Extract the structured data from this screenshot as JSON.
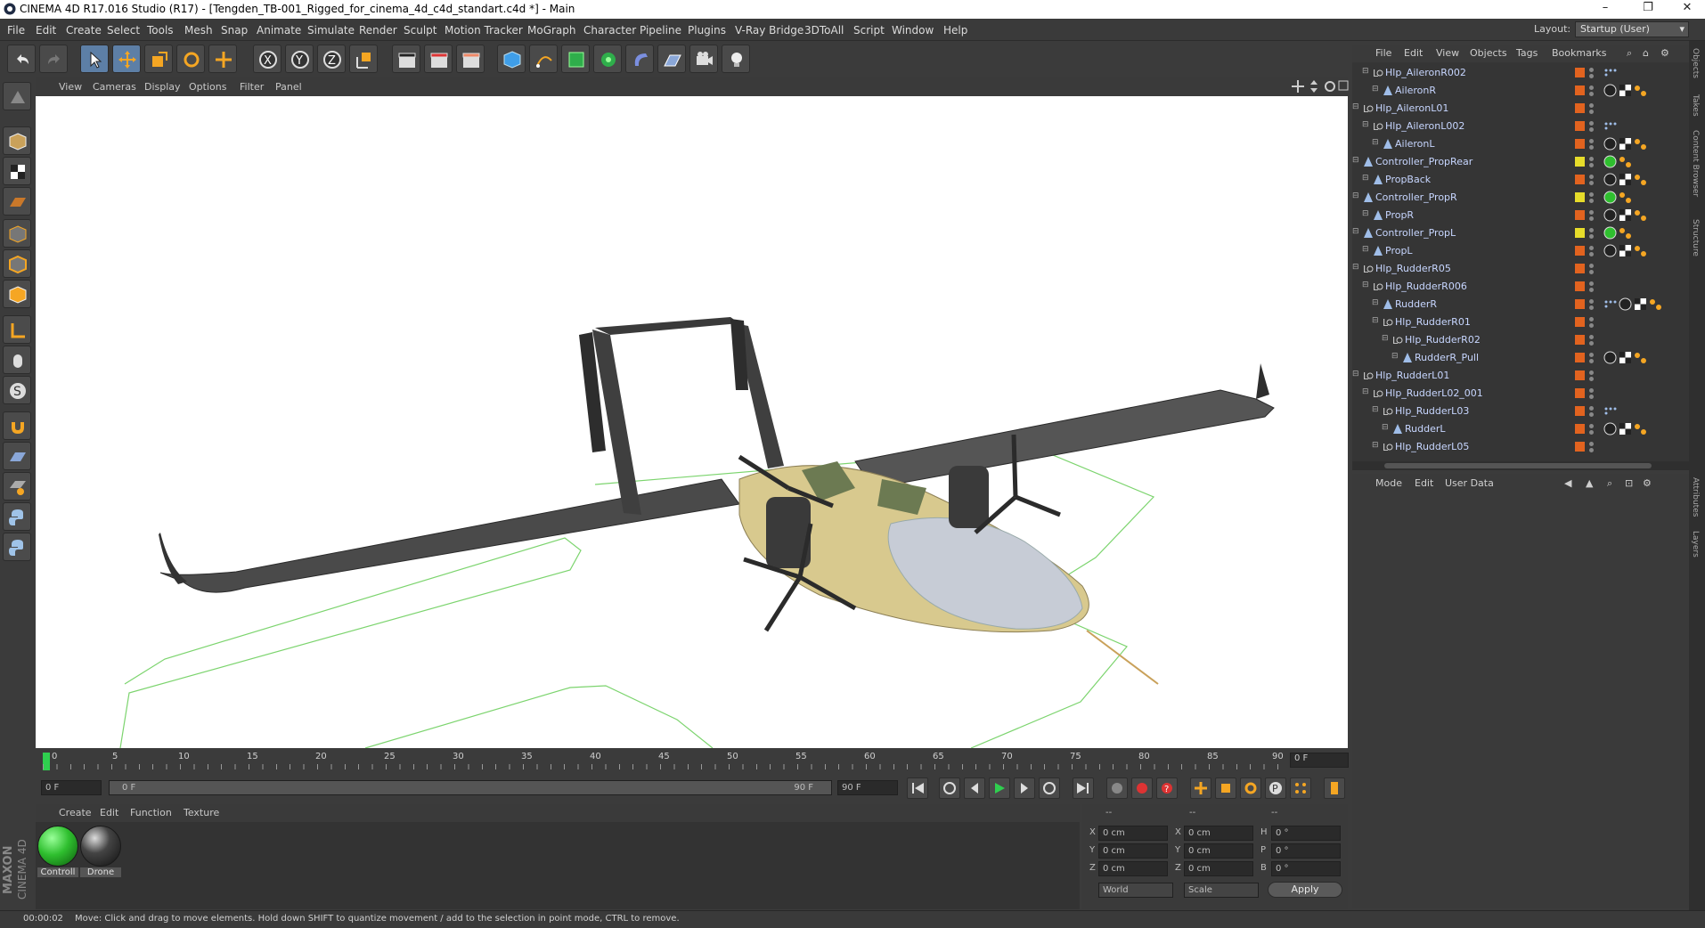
{
  "window": {
    "title": "CINEMA 4D R17.016 Studio (R17) - [Tengden_TB-001_Rigged_for_cinema_4d_c4d_standart.c4d *] - Main",
    "minimize": "–",
    "maximize": "❐",
    "close": "✕"
  },
  "menu": [
    "File",
    "Edit",
    "Create",
    "Select",
    "Tools",
    "Mesh",
    "Snap",
    "Animate",
    "Simulate",
    "Render",
    "Sculpt",
    "Motion Tracker",
    "MoGraph",
    "Character",
    "Pipeline",
    "Plugins",
    "V-Ray Bridge",
    "3DToAll",
    "Script",
    "Window",
    "Help"
  ],
  "layout": {
    "label": "Layout:",
    "value": "Startup (User)"
  },
  "viewport_menu": [
    "View",
    "Cameras",
    "Display",
    "Options",
    "Filter",
    "Panel"
  ],
  "timeline": {
    "ticks": [
      "0",
      "5",
      "10",
      "15",
      "20",
      "25",
      "30",
      "35",
      "40",
      "45",
      "50",
      "55",
      "60",
      "65",
      "70",
      "75",
      "80",
      "85",
      "90"
    ],
    "current_frame": "0 F",
    "start": "0 F",
    "range_start": "0 F",
    "range_end": "90 F",
    "end": "90 F"
  },
  "material_menu": [
    "Create",
    "Edit",
    "Function",
    "Texture"
  ],
  "materials": [
    {
      "name": "Controll",
      "color": "#2fbf2f"
    },
    {
      "name": "Drone",
      "color": "#2a2a2a"
    }
  ],
  "coords": {
    "headers": [
      "--",
      "--",
      "--"
    ],
    "rows": [
      {
        "a": "X",
        "av": "0 cm",
        "b": "X",
        "bv": "0 cm",
        "c": "H",
        "cv": "0 °"
      },
      {
        "a": "Y",
        "av": "0 cm",
        "b": "Y",
        "bv": "0 cm",
        "c": "P",
        "cv": "0 °"
      },
      {
        "a": "Z",
        "av": "0 cm",
        "b": "Z",
        "bv": "0 cm",
        "c": "B",
        "cv": "0 °"
      }
    ],
    "world": "World",
    "scale": "Scale",
    "apply": "Apply"
  },
  "brand": {
    "line1": "MAXON",
    "line2": "CINEMA 4D"
  },
  "status": {
    "time": "00:00:02",
    "message": "Move: Click and drag to move elements. Hold down SHIFT to quantize movement / add to the selection in point mode, CTRL to remove."
  },
  "object_manager": {
    "menu": [
      "File",
      "Edit",
      "View",
      "Objects",
      "Tags",
      "Bookmarks"
    ],
    "rows": [
      {
        "name": "Hlp_AileronR002",
        "indent": 1,
        "icon": "null",
        "flag": "orange",
        "tags": [
          "dots"
        ]
      },
      {
        "name": "AileronR",
        "indent": 2,
        "icon": "joint",
        "flag": "orange",
        "tags": [
          "ball",
          "checker",
          "orange"
        ]
      },
      {
        "name": "Hlp_AileronL01",
        "indent": 0,
        "icon": "null",
        "flag": "orange",
        "tags": []
      },
      {
        "name": "Hlp_AileronL002",
        "indent": 1,
        "icon": "null",
        "flag": "orange",
        "tags": [
          "dots"
        ]
      },
      {
        "name": "AileronL",
        "indent": 2,
        "icon": "joint",
        "flag": "orange",
        "tags": [
          "ball",
          "checker",
          "orange"
        ]
      },
      {
        "name": "Controller_PropRear",
        "indent": 0,
        "icon": "joint",
        "flag": "yellow",
        "tags": [
          "green",
          "orange"
        ]
      },
      {
        "name": "PropBack",
        "indent": 1,
        "icon": "joint",
        "flag": "orange",
        "tags": [
          "ball",
          "checker",
          "orange"
        ]
      },
      {
        "name": "Controller_PropR",
        "indent": 0,
        "icon": "joint",
        "flag": "yellow",
        "tags": [
          "green",
          "orange"
        ]
      },
      {
        "name": "PropR",
        "indent": 1,
        "icon": "joint",
        "flag": "orange",
        "tags": [
          "ball",
          "checker",
          "orange"
        ]
      },
      {
        "name": "Controller_PropL",
        "indent": 0,
        "icon": "joint",
        "flag": "yellow",
        "tags": [
          "green",
          "orange"
        ]
      },
      {
        "name": "PropL",
        "indent": 1,
        "icon": "joint",
        "flag": "orange",
        "tags": [
          "ball",
          "checker",
          "orange"
        ]
      },
      {
        "name": "Hlp_RudderR05",
        "indent": 0,
        "icon": "null",
        "flag": "orange",
        "tags": []
      },
      {
        "name": "Hlp_RudderR006",
        "indent": 1,
        "icon": "null",
        "flag": "orange",
        "tags": []
      },
      {
        "name": "RudderR",
        "indent": 2,
        "icon": "joint",
        "flag": "orange",
        "tags": [
          "dots",
          "ball",
          "checker",
          "orange"
        ]
      },
      {
        "name": "Hlp_RudderR01",
        "indent": 2,
        "icon": "null",
        "flag": "orange",
        "tags": []
      },
      {
        "name": "Hlp_RudderR02",
        "indent": 3,
        "icon": "null",
        "flag": "orange",
        "tags": []
      },
      {
        "name": "RudderR_Pull",
        "indent": 4,
        "icon": "joint",
        "flag": "orange",
        "tags": [
          "ball",
          "checker",
          "orange"
        ]
      },
      {
        "name": "Hlp_RudderL01",
        "indent": 0,
        "icon": "null",
        "flag": "orange",
        "tags": []
      },
      {
        "name": "Hlp_RudderL02_001",
        "indent": 1,
        "icon": "null",
        "flag": "orange",
        "tags": []
      },
      {
        "name": "Hlp_RudderL03",
        "indent": 2,
        "icon": "null",
        "flag": "orange",
        "tags": [
          "dots"
        ]
      },
      {
        "name": "RudderL",
        "indent": 3,
        "icon": "joint",
        "flag": "orange",
        "tags": [
          "ball",
          "checker",
          "orange"
        ]
      },
      {
        "name": "Hlp_RudderL05",
        "indent": 2,
        "icon": "null",
        "flag": "orange",
        "tags": []
      }
    ]
  },
  "attributes": {
    "menu": [
      "Mode",
      "Edit",
      "User Data"
    ]
  },
  "side_tabs": [
    "Objects",
    "Takes",
    "Content Browser",
    "Structure",
    "Attributes",
    "Layers"
  ]
}
